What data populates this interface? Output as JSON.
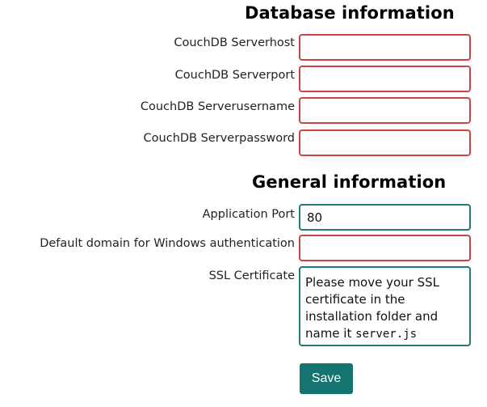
{
  "database_section": {
    "title": "Database information",
    "fields": [
      {
        "label": "CouchDB Serverhost",
        "value": ""
      },
      {
        "label": "CouchDB Serverport",
        "value": ""
      },
      {
        "label": "CouchDB Serverusername",
        "value": ""
      },
      {
        "label": "CouchDB Serverpassword",
        "value": ""
      }
    ]
  },
  "general_section": {
    "title": "General information",
    "application_port": {
      "label": "Application Port",
      "value": "80"
    },
    "default_domain": {
      "label": "Default domain for Windows authentication",
      "value": ""
    },
    "ssl_certificate": {
      "label": "SSL Certificate",
      "text": "Please move your SSL certificate in the installation folder and name it",
      "filename": "server.js"
    }
  },
  "actions": {
    "save_label": "Save"
  },
  "colors": {
    "invalid_border": "#cc4444",
    "valid_border": "#1f7b7b",
    "primary_button": "#147470"
  }
}
